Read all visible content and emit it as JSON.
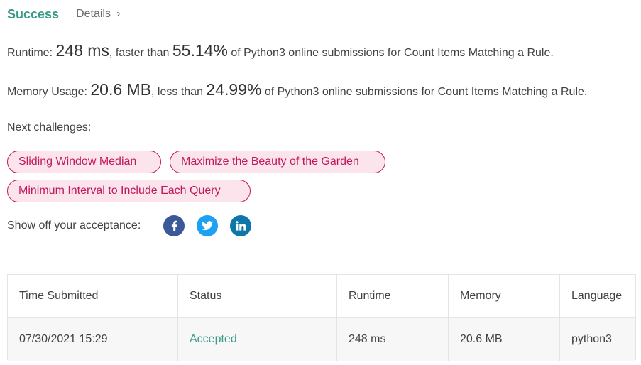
{
  "header": {
    "status": "Success",
    "details_label": "Details",
    "details_chevron": "›"
  },
  "runtime": {
    "label": "Runtime:",
    "value": "248 ms",
    "comparison": ", faster than",
    "percent": "55.14%",
    "suffix": "of Python3 online submissions for Count Items Matching a Rule."
  },
  "memory": {
    "label": "Memory Usage:",
    "value": "20.6 MB",
    "comparison": ", less than",
    "percent": "24.99%",
    "suffix": "of Python3 online submissions for Count Items Matching a Rule."
  },
  "next_challenges": {
    "label": "Next challenges:",
    "items": [
      "Sliding Window Median",
      "Maximize the Beauty of the Garden",
      "Minimum Interval to Include Each Query"
    ]
  },
  "share": {
    "label": "Show off your acceptance:",
    "icons": [
      {
        "name": "facebook-icon",
        "color": "#3b5998"
      },
      {
        "name": "twitter-icon",
        "color": "#1da1f2"
      },
      {
        "name": "linkedin-icon",
        "color": "#0e76a8"
      }
    ]
  },
  "table": {
    "headers": [
      "Time Submitted",
      "Status",
      "Runtime",
      "Memory",
      "Language"
    ],
    "rows": [
      {
        "time": "07/30/2021 15:29",
        "status": "Accepted",
        "runtime": "248 ms",
        "memory": "20.6 MB",
        "language": "python3"
      }
    ]
  },
  "colors": {
    "success": "#3a9a88",
    "challenge_border": "#c2185b",
    "challenge_bg": "#fce4ec",
    "accepted": "#3a9a88"
  }
}
